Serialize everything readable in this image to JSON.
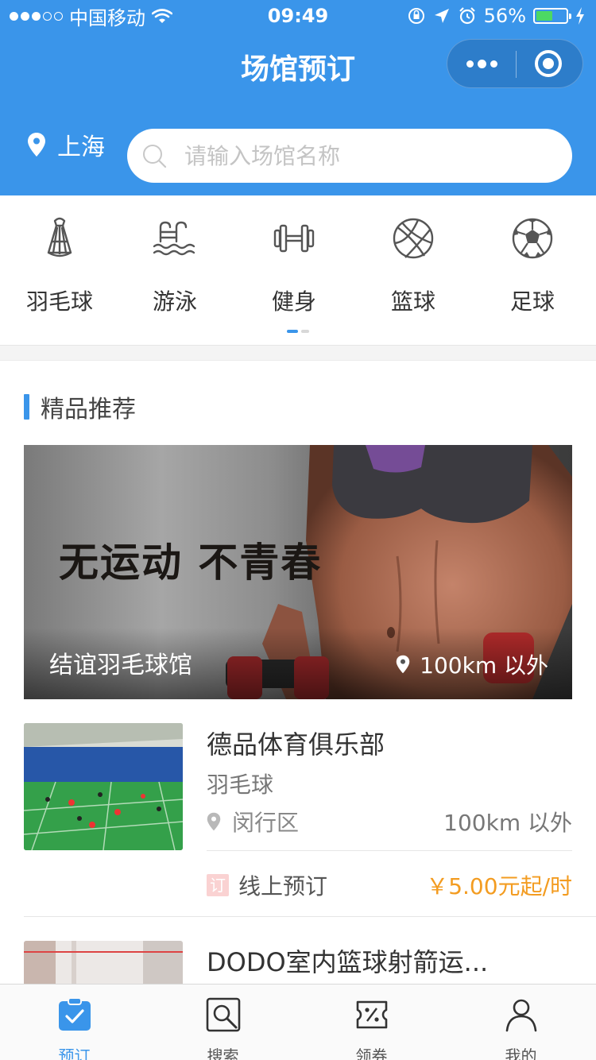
{
  "status_bar": {
    "carrier": "中国移动",
    "time": "09:49",
    "battery_percent": "56%",
    "battery_level": 0.56
  },
  "nav": {
    "title": "场馆预订"
  },
  "location": {
    "city": "上海"
  },
  "search": {
    "placeholder": "请输入场馆名称"
  },
  "categories": [
    {
      "label": "羽毛球",
      "icon": "shuttlecock-icon"
    },
    {
      "label": "游泳",
      "icon": "swimming-icon"
    },
    {
      "label": "健身",
      "icon": "dumbbell-icon"
    },
    {
      "label": "篮球",
      "icon": "basketball-icon"
    },
    {
      "label": "足球",
      "icon": "soccer-ball-icon"
    }
  ],
  "section": {
    "title": "精品推荐"
  },
  "banner": {
    "slogan": "无运动 不青春",
    "venue_name": "结谊羽毛球馆",
    "distance": "100km 以外"
  },
  "venues": [
    {
      "name": "德品体育俱乐部",
      "sport": "羽毛球",
      "district": "闵行区",
      "distance": "100km 以外",
      "booking_tag": "订",
      "booking_label": "线上预订",
      "price": "￥5.00元起/时"
    },
    {
      "name": "DODO室内篮球射箭运..."
    }
  ],
  "tabbar": [
    {
      "label": "预订",
      "icon": "booking-icon",
      "active": true
    },
    {
      "label": "搜索",
      "icon": "search-icon",
      "active": false
    },
    {
      "label": "领券",
      "icon": "coupon-icon",
      "active": false
    },
    {
      "label": "我的",
      "icon": "profile-icon",
      "active": false
    }
  ],
  "colors": {
    "primary": "#3a95ea",
    "price": "#f39c21",
    "booking_tag": "#fad2d2",
    "battery": "#4cd964"
  }
}
